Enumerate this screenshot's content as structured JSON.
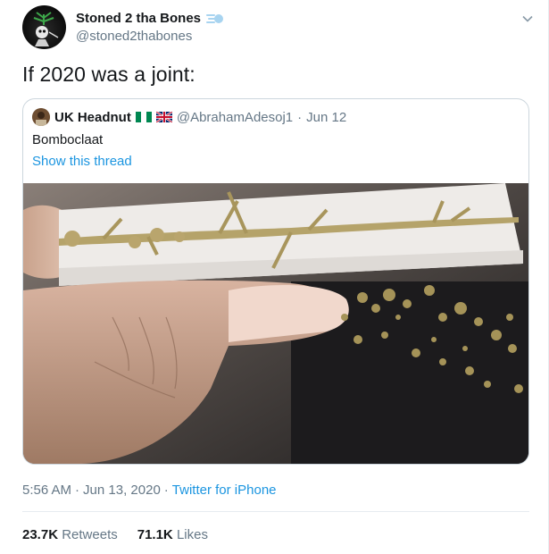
{
  "tweet": {
    "author": {
      "display_name": "Stoned 2 tha Bones",
      "handle": "@stoned2thabones",
      "emoji_icon": "dash-icon"
    },
    "text": "If 2020 was a joint:",
    "quoted": {
      "display_name": "UK Headnut",
      "flags": [
        "nigeria-flag-icon",
        "uk-flag-icon"
      ],
      "handle": "@AbrahamAdesoj1",
      "separator": "·",
      "date": "Jun 12",
      "text": "Bomboclaat",
      "thread_link": "Show this thread",
      "image_alt": "joint-photo"
    },
    "meta": {
      "time": "5:56 AM",
      "separator": "·",
      "date": "Jun 13, 2020",
      "source": "Twitter for iPhone"
    },
    "stats": {
      "retweets_count": "23.7K",
      "retweets_label": "Retweets",
      "likes_count": "71.1K",
      "likes_label": "Likes"
    }
  },
  "colors": {
    "link": "#1b95e0",
    "secondary_text": "#657786",
    "primary_text": "#14171a",
    "border": "#ccd6dd"
  }
}
